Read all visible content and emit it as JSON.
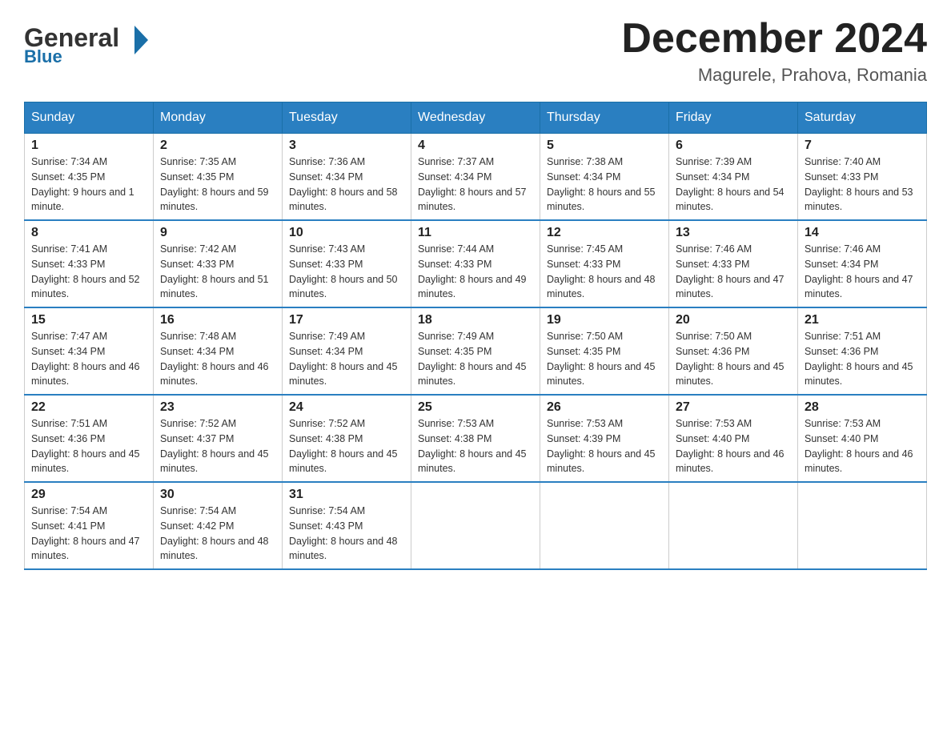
{
  "header": {
    "logo_general": "General",
    "logo_blue": "Blue",
    "month_title": "December 2024",
    "location": "Magurele, Prahova, Romania"
  },
  "days_of_week": [
    "Sunday",
    "Monday",
    "Tuesday",
    "Wednesday",
    "Thursday",
    "Friday",
    "Saturday"
  ],
  "weeks": [
    [
      {
        "day": "1",
        "sunrise": "7:34 AM",
        "sunset": "4:35 PM",
        "daylight": "9 hours and 1 minute."
      },
      {
        "day": "2",
        "sunrise": "7:35 AM",
        "sunset": "4:35 PM",
        "daylight": "8 hours and 59 minutes."
      },
      {
        "day": "3",
        "sunrise": "7:36 AM",
        "sunset": "4:34 PM",
        "daylight": "8 hours and 58 minutes."
      },
      {
        "day": "4",
        "sunrise": "7:37 AM",
        "sunset": "4:34 PM",
        "daylight": "8 hours and 57 minutes."
      },
      {
        "day": "5",
        "sunrise": "7:38 AM",
        "sunset": "4:34 PM",
        "daylight": "8 hours and 55 minutes."
      },
      {
        "day": "6",
        "sunrise": "7:39 AM",
        "sunset": "4:34 PM",
        "daylight": "8 hours and 54 minutes."
      },
      {
        "day": "7",
        "sunrise": "7:40 AM",
        "sunset": "4:33 PM",
        "daylight": "8 hours and 53 minutes."
      }
    ],
    [
      {
        "day": "8",
        "sunrise": "7:41 AM",
        "sunset": "4:33 PM",
        "daylight": "8 hours and 52 minutes."
      },
      {
        "day": "9",
        "sunrise": "7:42 AM",
        "sunset": "4:33 PM",
        "daylight": "8 hours and 51 minutes."
      },
      {
        "day": "10",
        "sunrise": "7:43 AM",
        "sunset": "4:33 PM",
        "daylight": "8 hours and 50 minutes."
      },
      {
        "day": "11",
        "sunrise": "7:44 AM",
        "sunset": "4:33 PM",
        "daylight": "8 hours and 49 minutes."
      },
      {
        "day": "12",
        "sunrise": "7:45 AM",
        "sunset": "4:33 PM",
        "daylight": "8 hours and 48 minutes."
      },
      {
        "day": "13",
        "sunrise": "7:46 AM",
        "sunset": "4:33 PM",
        "daylight": "8 hours and 47 minutes."
      },
      {
        "day": "14",
        "sunrise": "7:46 AM",
        "sunset": "4:34 PM",
        "daylight": "8 hours and 47 minutes."
      }
    ],
    [
      {
        "day": "15",
        "sunrise": "7:47 AM",
        "sunset": "4:34 PM",
        "daylight": "8 hours and 46 minutes."
      },
      {
        "day": "16",
        "sunrise": "7:48 AM",
        "sunset": "4:34 PM",
        "daylight": "8 hours and 46 minutes."
      },
      {
        "day": "17",
        "sunrise": "7:49 AM",
        "sunset": "4:34 PM",
        "daylight": "8 hours and 45 minutes."
      },
      {
        "day": "18",
        "sunrise": "7:49 AM",
        "sunset": "4:35 PM",
        "daylight": "8 hours and 45 minutes."
      },
      {
        "day": "19",
        "sunrise": "7:50 AM",
        "sunset": "4:35 PM",
        "daylight": "8 hours and 45 minutes."
      },
      {
        "day": "20",
        "sunrise": "7:50 AM",
        "sunset": "4:36 PM",
        "daylight": "8 hours and 45 minutes."
      },
      {
        "day": "21",
        "sunrise": "7:51 AM",
        "sunset": "4:36 PM",
        "daylight": "8 hours and 45 minutes."
      }
    ],
    [
      {
        "day": "22",
        "sunrise": "7:51 AM",
        "sunset": "4:36 PM",
        "daylight": "8 hours and 45 minutes."
      },
      {
        "day": "23",
        "sunrise": "7:52 AM",
        "sunset": "4:37 PM",
        "daylight": "8 hours and 45 minutes."
      },
      {
        "day": "24",
        "sunrise": "7:52 AM",
        "sunset": "4:38 PM",
        "daylight": "8 hours and 45 minutes."
      },
      {
        "day": "25",
        "sunrise": "7:53 AM",
        "sunset": "4:38 PM",
        "daylight": "8 hours and 45 minutes."
      },
      {
        "day": "26",
        "sunrise": "7:53 AM",
        "sunset": "4:39 PM",
        "daylight": "8 hours and 45 minutes."
      },
      {
        "day": "27",
        "sunrise": "7:53 AM",
        "sunset": "4:40 PM",
        "daylight": "8 hours and 46 minutes."
      },
      {
        "day": "28",
        "sunrise": "7:53 AM",
        "sunset": "4:40 PM",
        "daylight": "8 hours and 46 minutes."
      }
    ],
    [
      {
        "day": "29",
        "sunrise": "7:54 AM",
        "sunset": "4:41 PM",
        "daylight": "8 hours and 47 minutes."
      },
      {
        "day": "30",
        "sunrise": "7:54 AM",
        "sunset": "4:42 PM",
        "daylight": "8 hours and 48 minutes."
      },
      {
        "day": "31",
        "sunrise": "7:54 AM",
        "sunset": "4:43 PM",
        "daylight": "8 hours and 48 minutes."
      },
      null,
      null,
      null,
      null
    ]
  ],
  "labels": {
    "sunrise": "Sunrise:",
    "sunset": "Sunset:",
    "daylight": "Daylight:"
  }
}
